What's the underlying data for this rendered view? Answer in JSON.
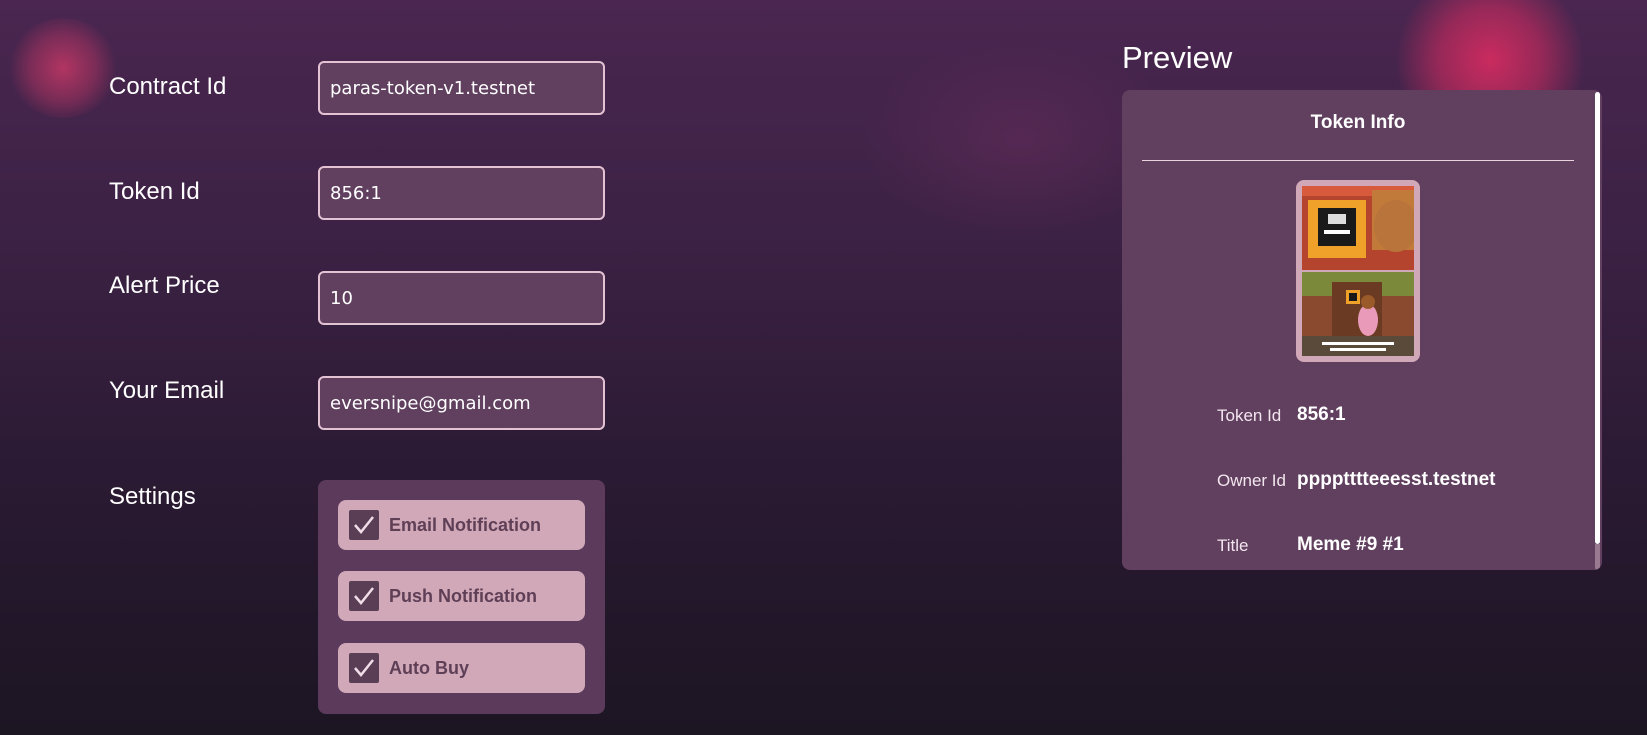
{
  "form": {
    "contract_id": {
      "label": "Contract Id",
      "value": "paras-token-v1.testnet"
    },
    "token_id": {
      "label": "Token Id",
      "value": "856:1"
    },
    "alert_price": {
      "label": "Alert Price",
      "value": "10"
    },
    "email": {
      "label": "Your Email",
      "value": "eversnipe@gmail.com"
    },
    "settings": {
      "label": "Settings",
      "options": [
        {
          "label": "Email Notification",
          "checked": true
        },
        {
          "label": "Push Notification",
          "checked": true
        },
        {
          "label": "Auto Buy",
          "checked": true
        }
      ]
    }
  },
  "preview": {
    "title": "Preview",
    "card_heading": "Token Info",
    "token_image_icon": "token-image",
    "fields": [
      {
        "label": "Token Id",
        "value": "856:1"
      },
      {
        "label": "Owner Id",
        "value": "pppptttteeesst.testnet"
      },
      {
        "label": "Title",
        "value": "Meme #9 #1"
      }
    ]
  },
  "colors": {
    "accent_glow": "#e22c62",
    "input_background": "#603f5f",
    "input_border": "#e3c3d3",
    "checkbox_row": "#d0a8b8",
    "checkbox_label": "#5f3f56"
  }
}
